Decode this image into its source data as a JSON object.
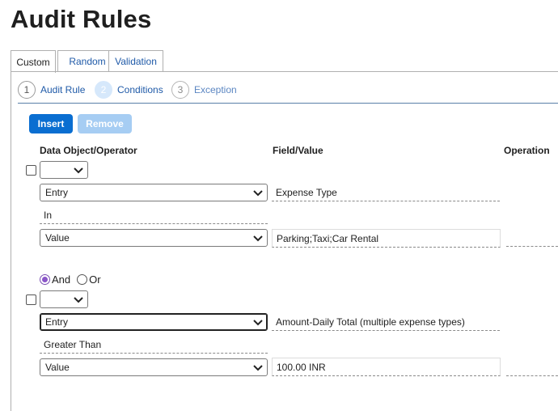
{
  "page": {
    "title": "Audit Rules"
  },
  "tabs": [
    {
      "label": "Custom",
      "active": true
    },
    {
      "label": "Random",
      "active": false
    },
    {
      "label": "Validation",
      "active": false
    }
  ],
  "steps": [
    {
      "number": "1",
      "label": "Audit Rule",
      "state": "done"
    },
    {
      "number": "2",
      "label": "Conditions",
      "state": "active"
    },
    {
      "number": "3",
      "label": "Exception",
      "state": "future"
    }
  ],
  "toolbar": {
    "insert_label": "Insert",
    "remove_label": "Remove"
  },
  "columns": {
    "data_object": "Data Object/Operator",
    "field_value": "Field/Value",
    "operation": "Operation"
  },
  "conditions": [
    {
      "paren_select": "",
      "entry_select": "Entry",
      "field": "Expense Type",
      "operator": "In",
      "value_select": "Value",
      "value": "Parking;Taxi;Car Rental"
    },
    {
      "paren_select": "",
      "entry_select": "Entry",
      "field": "Amount-Daily Total (multiple expense types)",
      "operator": "Greater Than",
      "value_select": "Value",
      "value": "100.00 INR"
    }
  ],
  "logic": {
    "and_label": "And",
    "or_label": "Or",
    "selected": "And"
  },
  "colors": {
    "accent": "#0a6ed1",
    "accent_disabled": "#a6cdf3",
    "radio": "#8a56c9"
  }
}
